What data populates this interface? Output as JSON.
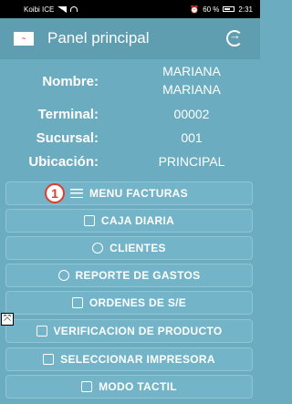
{
  "status_bar": {
    "carrier": "Koibi ICE",
    "battery": "60 %",
    "time": "2:31"
  },
  "app_bar": {
    "title": "Panel principal",
    "logo_icon": "coca-cola-logo",
    "exit_icon": "logout-icon"
  },
  "info": {
    "nombre_label": "Nombre:",
    "nombre_value_line1": "MARIANA",
    "nombre_value_line2": "MARIANA",
    "terminal_label": "Terminal:",
    "terminal_value": "00002",
    "sucursal_label": "Sucursal:",
    "sucursal_value": "001",
    "ubicacion_label": "Ubicación:",
    "ubicacion_value": "PRINCIPAL"
  },
  "menu": {
    "badge": "1",
    "items": [
      {
        "label": "MENU FACTURAS",
        "icon": "menu-icon"
      },
      {
        "label": "CAJA DIARIA",
        "icon": "cash-register-icon"
      },
      {
        "label": "CLIENTES",
        "icon": "users-icon"
      },
      {
        "label": "REPORTE DE GASTOS",
        "icon": "report-icon"
      },
      {
        "label": "ORDENES DE S/E",
        "icon": "orders-icon"
      },
      {
        "label": "VERIFICACION DE PRODUCTO",
        "icon": "product-check-icon"
      },
      {
        "label": "SELECCIONAR IMPRESORA",
        "icon": "printer-icon"
      },
      {
        "label": "MODO TACTIL",
        "icon": "touch-icon"
      }
    ]
  },
  "colors": {
    "background": "#6bacc1",
    "app_bar": "#5f9db1",
    "badge": "#e23b2e"
  }
}
